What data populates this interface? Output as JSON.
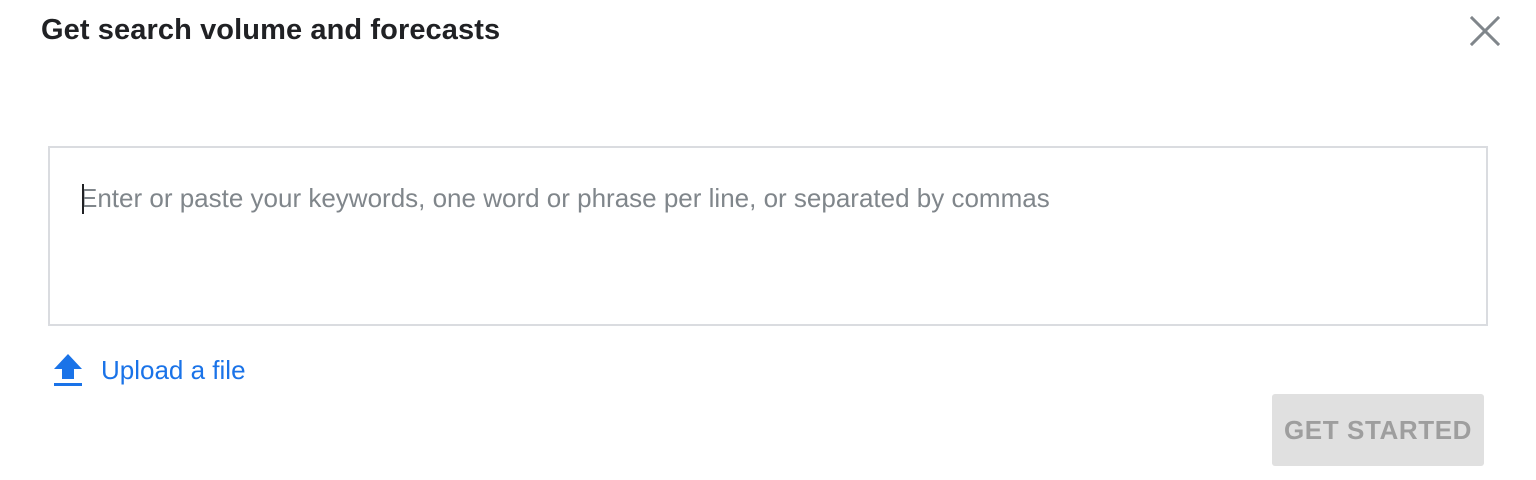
{
  "dialog": {
    "title": "Get search volume and forecasts",
    "close_icon": "close-icon"
  },
  "keywords": {
    "placeholder": "Enter or paste your keywords, one word or phrase per line, or separated by commas",
    "value": ""
  },
  "upload": {
    "label": "Upload a file",
    "icon": "upload-icon"
  },
  "actions": {
    "get_started_label": "GET STARTED",
    "get_started_enabled": false
  },
  "colors": {
    "accent": "#1a73e8",
    "title_text": "#202124",
    "placeholder_text": "#80868b",
    "input_border": "#dadce0",
    "disabled_button_bg": "#e0e0e0",
    "disabled_button_text": "#9e9e9e",
    "close_icon": "#80868b"
  }
}
